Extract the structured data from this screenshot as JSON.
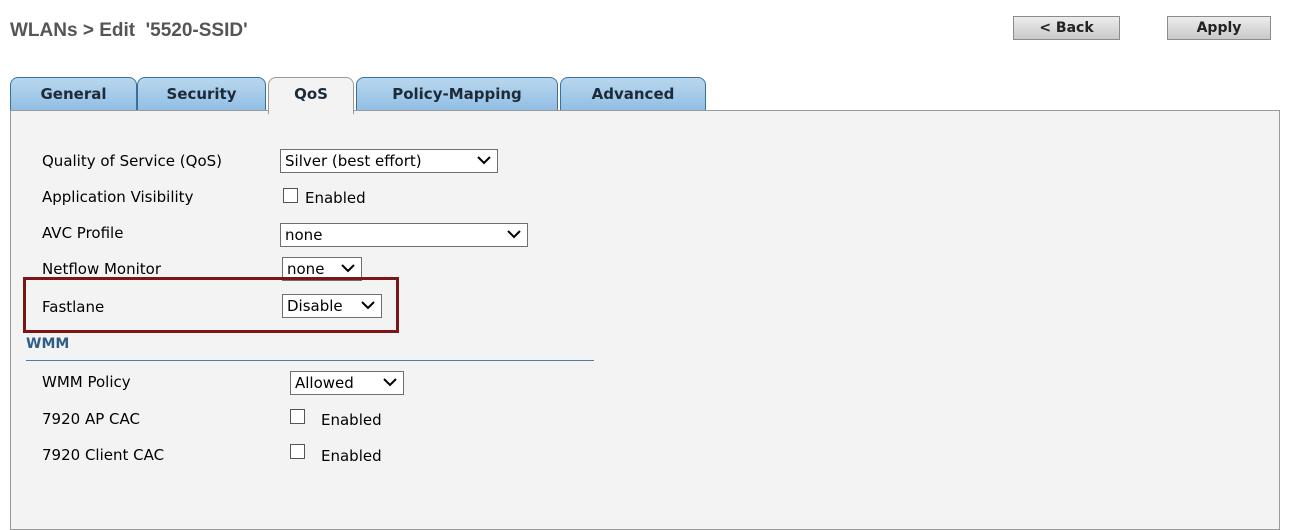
{
  "header": {
    "title": "WLANs > Edit  '5520-SSID'",
    "back_label": "< Back",
    "apply_label": "Apply"
  },
  "tabs": [
    {
      "label": "General",
      "active": false
    },
    {
      "label": "Security",
      "active": false
    },
    {
      "label": "QoS",
      "active": true
    },
    {
      "label": "Policy-Mapping",
      "active": false
    },
    {
      "label": "Advanced",
      "active": false
    }
  ],
  "qos": {
    "quality_of_service": {
      "label": "Quality of Service (QoS)",
      "value": "Silver (best effort)"
    },
    "application_visibility": {
      "label": "Application Visibility",
      "checkbox_label": "Enabled",
      "checked": false
    },
    "avc_profile": {
      "label": "AVC Profile",
      "value": "none"
    },
    "netflow_monitor": {
      "label": "Netflow Monitor",
      "value": "none"
    },
    "fastlane": {
      "label": "Fastlane",
      "value": "Disable"
    }
  },
  "wmm": {
    "heading": "WMM",
    "policy": {
      "label": "WMM Policy",
      "value": "Allowed"
    },
    "ap_cac": {
      "label": "7920 AP CAC",
      "checkbox_label": "Enabled",
      "checked": false
    },
    "client_cac": {
      "label": "7920 Client CAC",
      "checkbox_label": "Enabled",
      "checked": false
    }
  },
  "colors": {
    "tab_gradient_top": "#b9d7ee",
    "tab_gradient_bottom": "#8fbde3",
    "panel_background": "#f3f3f3",
    "highlight_border": "#7b1616",
    "section_heading": "#2f5f86"
  }
}
